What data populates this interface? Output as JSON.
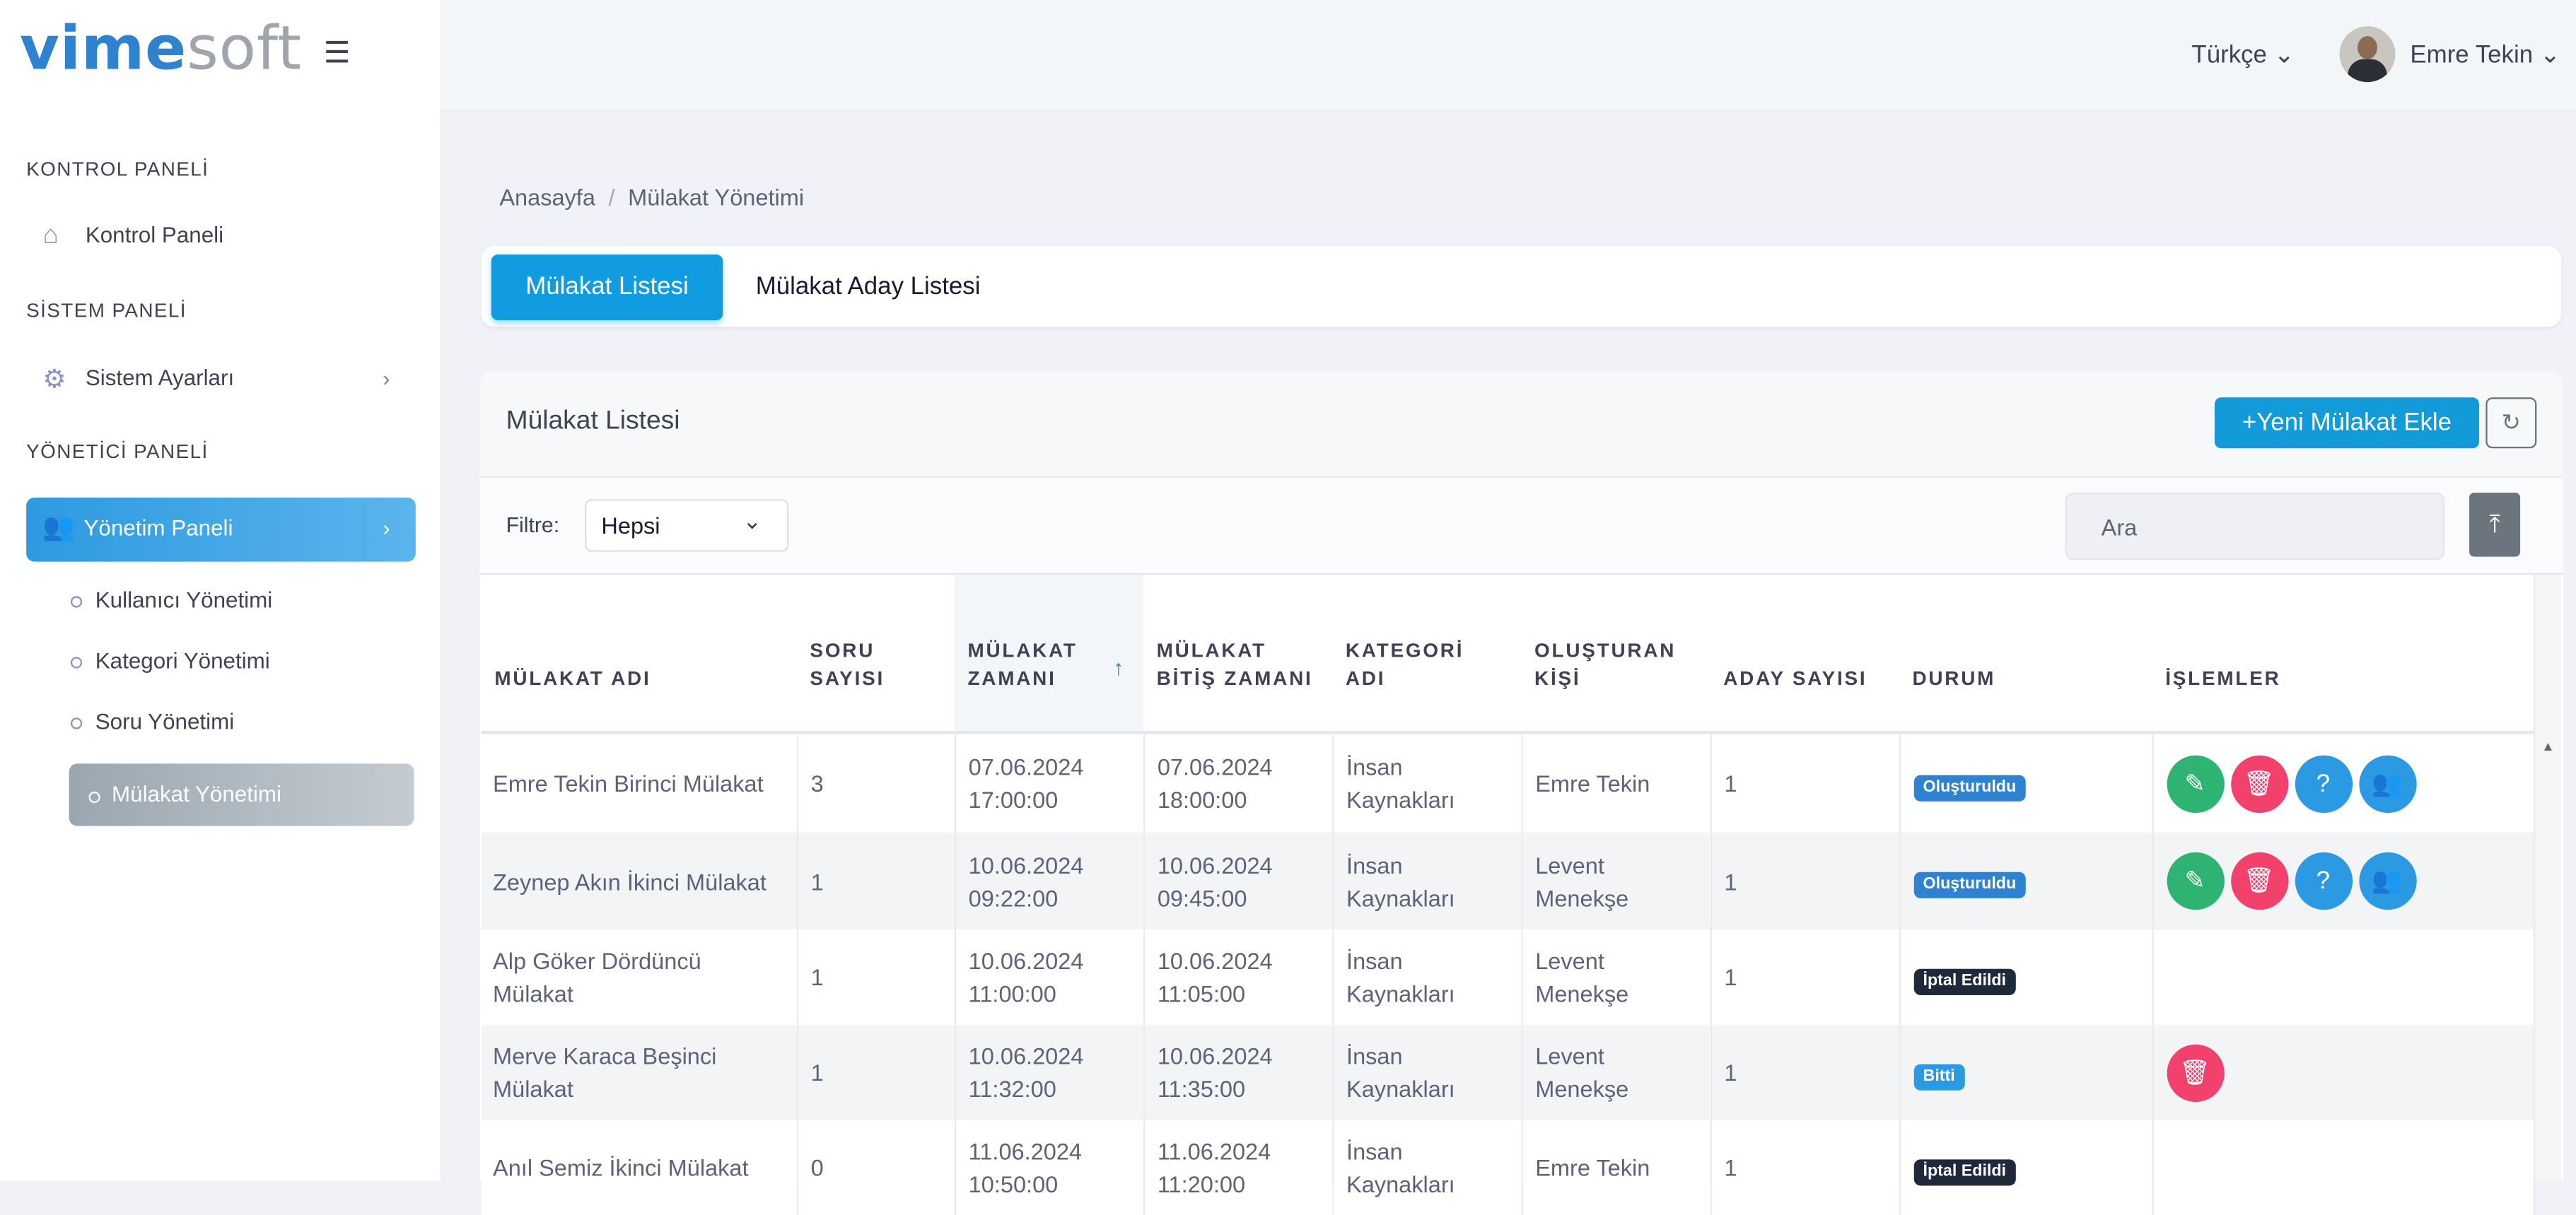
{
  "brand": {
    "logo_bold": "vime",
    "logo_light": "soft"
  },
  "header": {
    "language": "Türkçe ⌄",
    "user_name": "Emre Tekin ⌄"
  },
  "sidebar": {
    "sections": [
      {
        "title": "KONTROL PANELİ",
        "item": "Kontrol Paneli"
      },
      {
        "title": "SİSTEM PANELİ",
        "item": "Sistem Ayarları"
      },
      {
        "title": "YÖNETİCİ PANELİ",
        "item": "Yönetim Paneli"
      }
    ],
    "subitems": [
      "Kullanıcı Yönetimi",
      "Kategori Yönetimi",
      "Soru Yönetimi",
      "Mülakat Yönetimi"
    ]
  },
  "breadcrumb": {
    "home": "Anasayfa",
    "current": "Mülakat Yönetimi"
  },
  "tabs": [
    "Mülakat Listesi",
    "Mülakat Aday Listesi"
  ],
  "card": {
    "title": "Mülakat Listesi",
    "add_button": "+Yeni Mülakat Ekle",
    "filter_label": "Filtre:",
    "filter_value": "Hepsi",
    "search_placeholder": "Ara"
  },
  "table": {
    "headers": [
      "MÜLAKAT ADI",
      "SORU SAYISI",
      "MÜLAKAT ZAMANI",
      "MÜLAKAT BİTİŞ ZAMANI",
      "KATEGORİ ADI",
      "OLUŞTURAN KİŞİ",
      "ADAY SAYISI",
      "DURUM",
      "İŞLEMLER"
    ],
    "rows": [
      {
        "name": "Emre Tekin Birinci Mülakat",
        "questions": "3",
        "start": "07.06.2024 17:00:00",
        "end": "07.06.2024 18:00:00",
        "category": "İnsan Kaynakları",
        "creator": "Emre Tekin",
        "candidates": "1",
        "status": "Oluşturuldu",
        "status_color": "#2f82cf",
        "actions": [
          "edit",
          "delete",
          "help",
          "users"
        ]
      },
      {
        "name": "Zeynep Akın İkinci Mülakat",
        "questions": "1",
        "start": "10.06.2024 09:22:00",
        "end": "10.06.2024 09:45:00",
        "category": "İnsan Kaynakları",
        "creator": "Levent Menekşe",
        "candidates": "1",
        "status": "Oluşturuldu",
        "status_color": "#2f82cf",
        "actions": [
          "edit",
          "delete",
          "help",
          "users"
        ]
      },
      {
        "name": "Alp Göker Dördüncü Mülakat",
        "questions": "1",
        "start": "10.06.2024 11:00:00",
        "end": "10.06.2024 11:05:00",
        "category": "İnsan Kaynakları",
        "creator": "Levent Menekşe",
        "candidates": "1",
        "status": "İptal Edildi",
        "status_color": "#1e2a3a",
        "actions": []
      },
      {
        "name": "Merve Karaca Beşinci Mülakat",
        "questions": "1",
        "start": "10.06.2024 11:32:00",
        "end": "10.06.2024 11:35:00",
        "category": "İnsan Kaynakları",
        "creator": "Levent Menekşe",
        "candidates": "1",
        "status": "Bitti",
        "status_color": "#2c9ae3",
        "actions": [
          "delete"
        ]
      },
      {
        "name": "Anıl Semiz İkinci Mülakat",
        "questions": "0",
        "start": "11.06.2024 10:50:00",
        "end": "11.06.2024 11:20:00",
        "category": "İnsan Kaynakları",
        "creator": "Emre Tekin",
        "candidates": "1",
        "status": "İptal Edildi",
        "status_color": "#1e2a3a",
        "actions": []
      }
    ]
  }
}
